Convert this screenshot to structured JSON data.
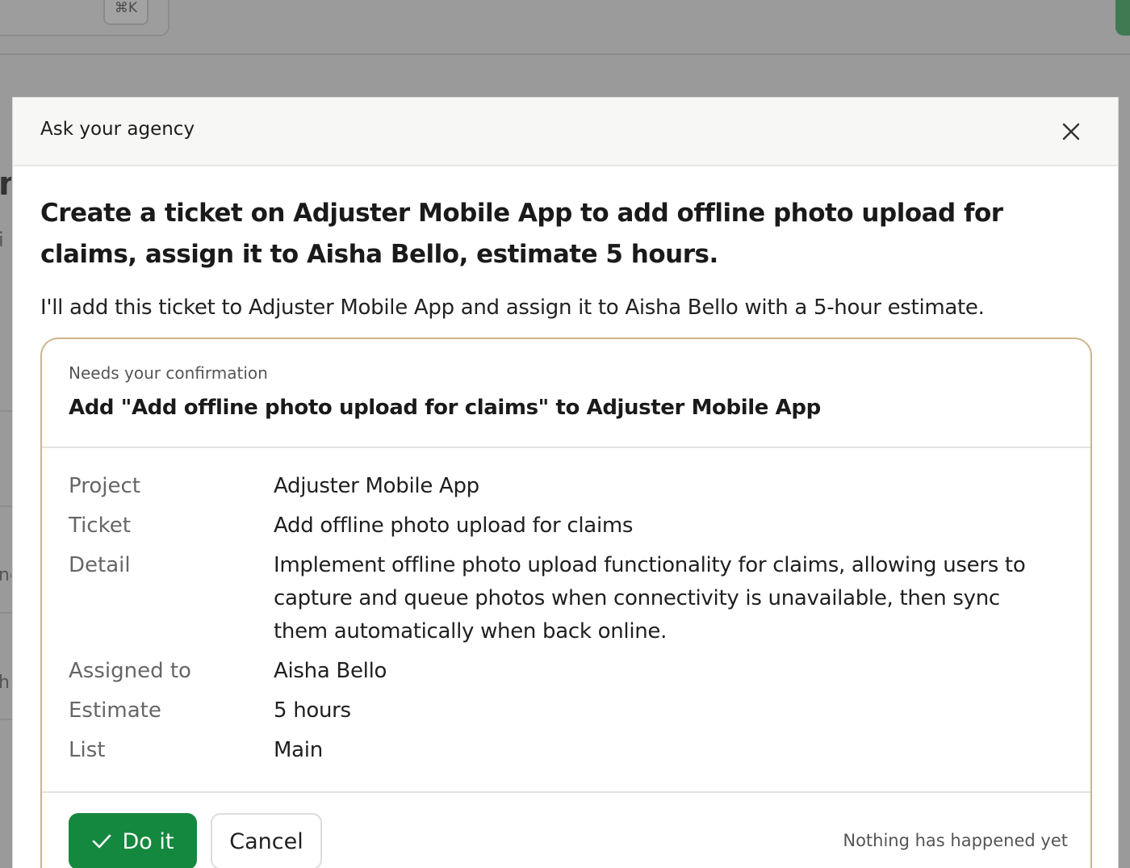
{
  "background": {
    "shortcut_hint": "⌘K",
    "fragments": [
      "n",
      "i",
      "ne",
      "h"
    ]
  },
  "modal": {
    "title": "Ask your agency",
    "close_icon": "close-icon"
  },
  "prompt": "Create a ticket on Adjuster Mobile App to add offline photo upload for claims, assign it to Aisha Bello, estimate 5 hours.",
  "reply": "I'll add this ticket to Adjuster Mobile App and assign it to Aisha Bello with a 5-hour estimate.",
  "confirmation": {
    "kicker": "Needs your confirmation",
    "action": "Add \"Add offline photo upload for claims\" to Adjuster Mobile App",
    "details": [
      {
        "label": "Project",
        "value": "Adjuster Mobile App"
      },
      {
        "label": "Ticket",
        "value": "Add offline photo upload for claims"
      },
      {
        "label": "Detail",
        "value": "Implement offline photo upload functionality for claims, allowing users to capture and queue photos when connectivity is unavailable, then sync them automatically when back online."
      },
      {
        "label": "Assigned to",
        "value": "Aisha Bello"
      },
      {
        "label": "Estimate",
        "value": "5 hours"
      },
      {
        "label": "List",
        "value": "Main"
      }
    ],
    "do_label": "Do it",
    "cancel_label": "Cancel",
    "status": "Nothing has happened yet"
  },
  "colors": {
    "accent": "#15883f",
    "card_border": "#cdb48a",
    "overlay": "#9a9a9a"
  }
}
